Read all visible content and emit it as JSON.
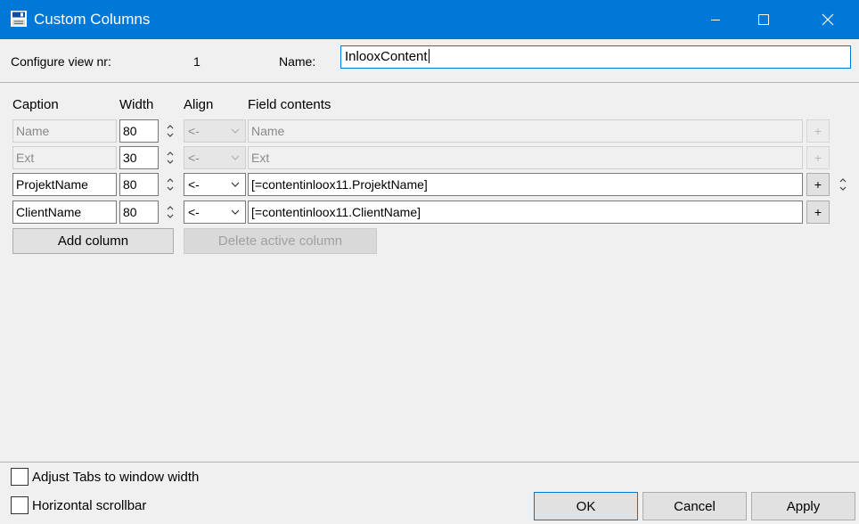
{
  "window": {
    "title": "Custom Columns",
    "icon": "save-icon"
  },
  "header": {
    "view_label": "Configure view nr:",
    "view_number": "1",
    "name_label": "Name:",
    "name_value": "InlooxContent"
  },
  "columns_header": {
    "caption": "Caption",
    "width": "Width",
    "align": "Align",
    "field": "Field contents"
  },
  "rows": [
    {
      "caption": "Name",
      "width": "80",
      "align": "<-",
      "field": "Name",
      "enabled": false
    },
    {
      "caption": "Ext",
      "width": "30",
      "align": "<-",
      "field": "Ext",
      "enabled": false
    },
    {
      "caption": "ProjektName",
      "width": "80",
      "align": "<-",
      "field": "[=contentinloox11.ProjektName]",
      "enabled": true
    },
    {
      "caption": "ClientName",
      "width": "80",
      "align": "<-",
      "field": "[=contentinloox11.ClientName]",
      "enabled": true
    }
  ],
  "row_buttons": {
    "insert": "+"
  },
  "actions": {
    "add_column": "Add column",
    "delete_column": "Delete active column"
  },
  "options": {
    "adjust_tabs": {
      "label": "Adjust Tabs to window width",
      "checked": false
    },
    "horizontal_scrollbar": {
      "label": "Horizontal scrollbar",
      "checked": false
    }
  },
  "footer": {
    "ok": "OK",
    "cancel": "Cancel",
    "apply": "Apply"
  },
  "colors": {
    "titlebar": "#0078d7",
    "dialog_bg": "#f0f0f0",
    "focus_border": "#0078d7"
  }
}
